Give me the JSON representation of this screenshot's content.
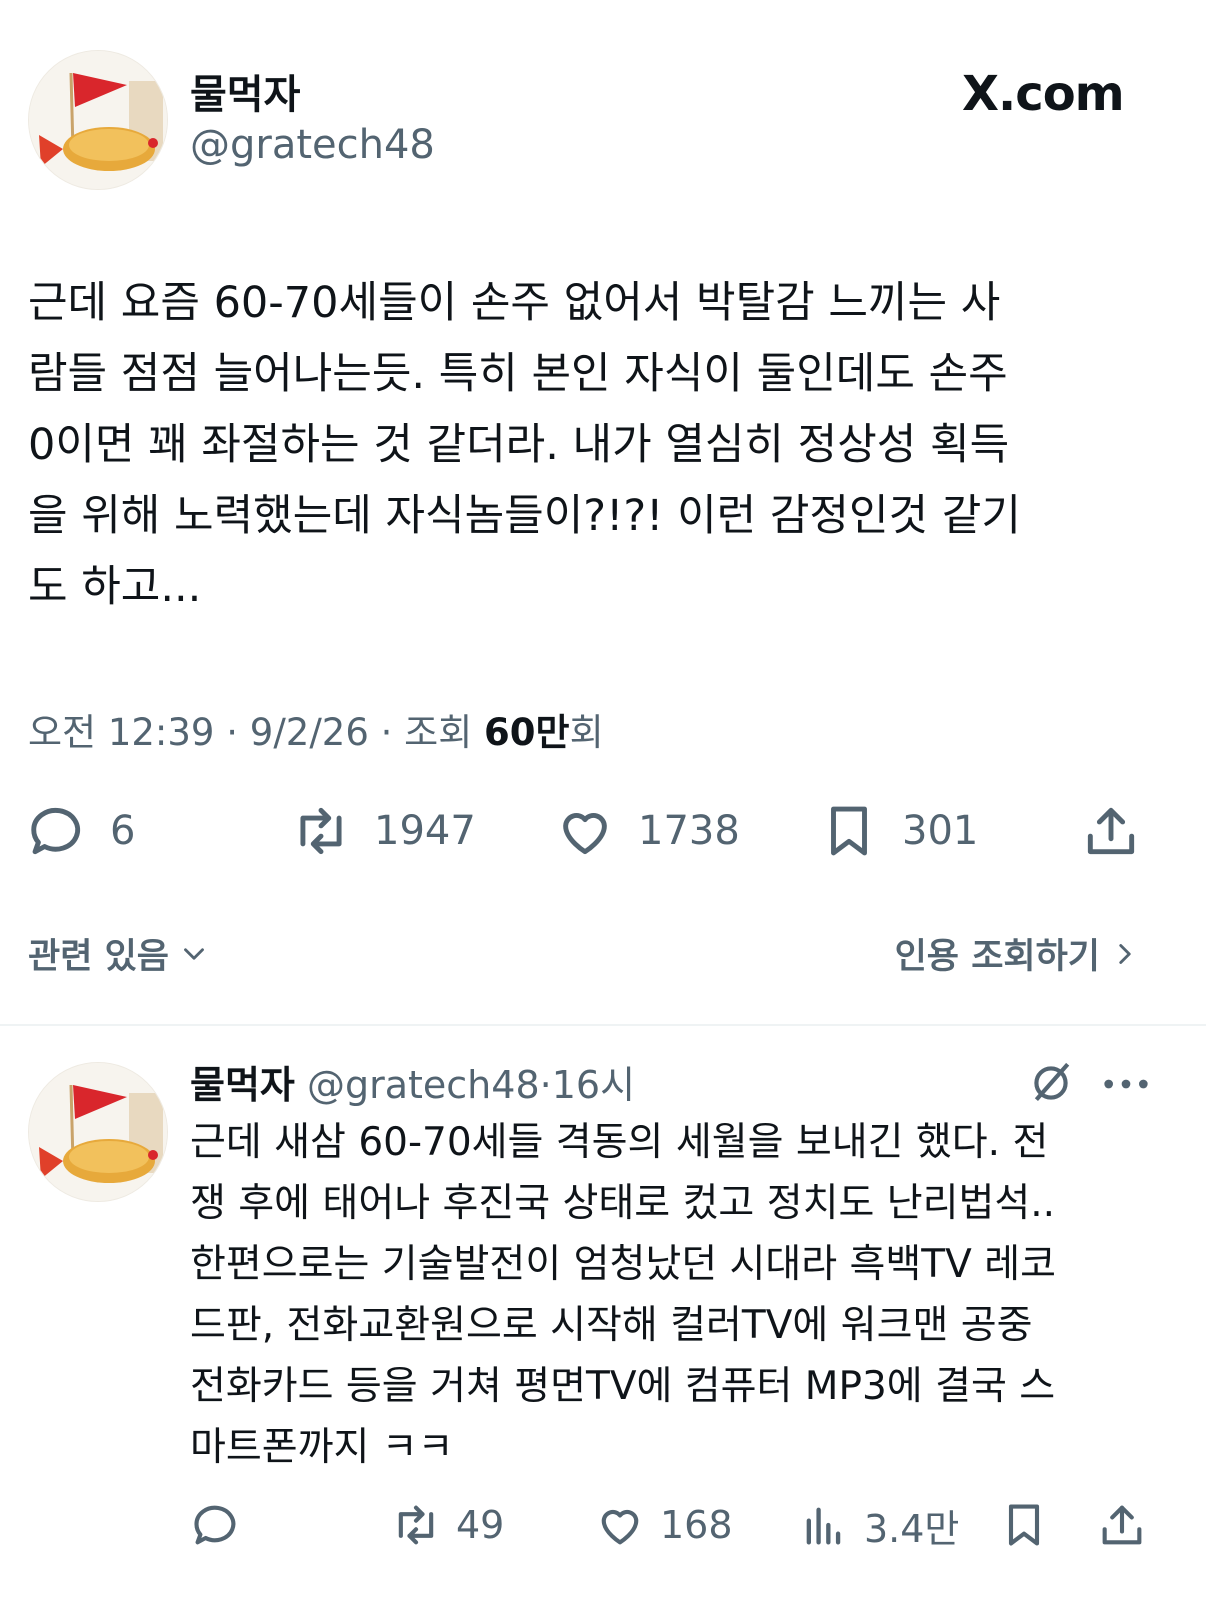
{
  "header": {
    "display_name": "물먹자",
    "handle": "@gratech48",
    "site_logo": "X.com"
  },
  "tweet": {
    "text": "근데 요즘 60-70세들이 손주 없어서 박탈감 느끼는 사\n람들 점점 늘어나는듯. 특히 본인 자식이 둘인데도 손주\n0이면 꽤 좌절하는 것 같더라. 내가 열심히 정상성 획득\n을 위해 노력했는데 자식놈들이?!?! 이런 감정인것 같기\n도 하고...",
    "time": "오전 12:39",
    "date": "9/2/26",
    "views_prefix": "조회",
    "views_value": "60만",
    "views_suffix": "회",
    "replies": "6",
    "retweets": "1947",
    "likes": "1738",
    "bookmarks": "301"
  },
  "related_label": "관련 있음",
  "quotes_label": "인용 조회하기",
  "reply": {
    "display_name": "물먹자",
    "handle": "@gratech48",
    "time": "16시",
    "text": "근데 새삼 60-70세들 격동의 세월을 보내긴 했다. 전\n쟁 후에 태어나 후진국 상태로 컸고 정치도 난리법석..\n한편으로는 기술발전이 엄청났던 시대라 흑백TV 레코\n드판, 전화교환원으로 시작해 컬러TV에 워크맨 공중\n전화카드 등을 거쳐 평면TV에 컴퓨터 MP3에 결국 스\n마트폰까지 ㅋㅋ",
    "replies": "",
    "retweets": "49",
    "likes": "168",
    "views": "3.4만"
  },
  "icons": {
    "avatar": "fried-shrimp-flag-avatar",
    "reply": "speech-bubble-icon",
    "retweet": "retweet-arrows-icon",
    "like": "heart-icon",
    "bookmark": "bookmark-icon",
    "share": "share-upload-icon",
    "views": "bar-chart-icon",
    "grok": "slashed-circle-icon",
    "more": "more-dots-icon"
  },
  "colors": {
    "text_primary": "#0f1419",
    "text_secondary": "#536471",
    "divider": "#eff3f4"
  }
}
